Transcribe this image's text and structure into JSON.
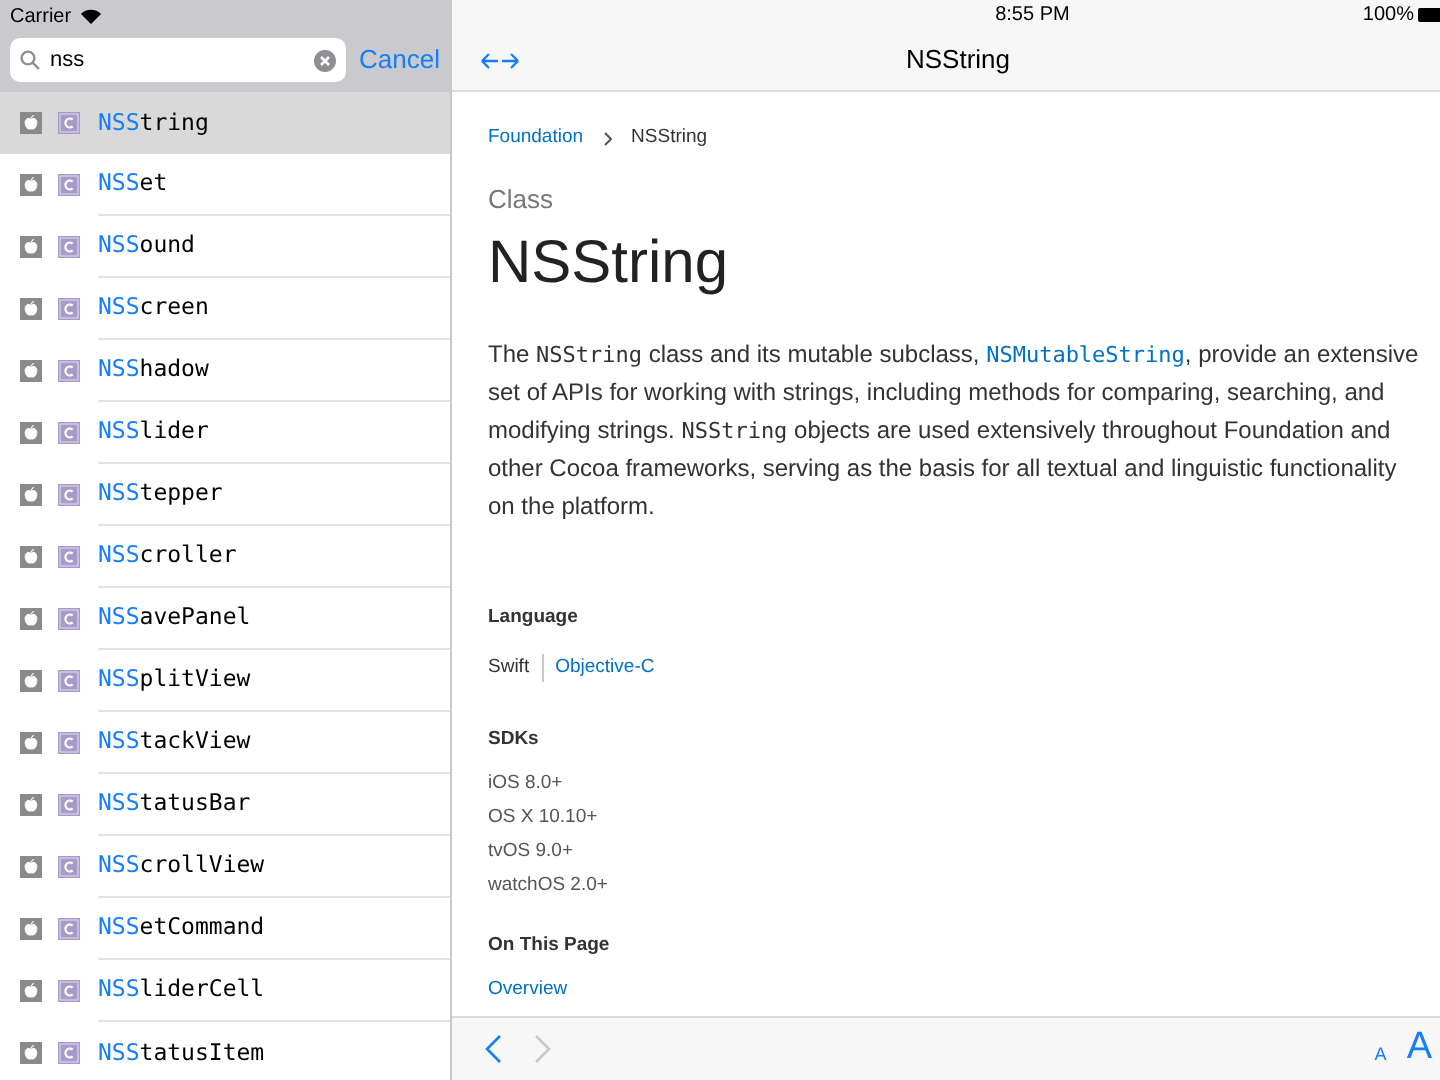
{
  "status_bar": {
    "carrier": "Carrier",
    "time": "8:55 PM",
    "battery": "100%"
  },
  "search": {
    "value": "nss",
    "cancel": "Cancel"
  },
  "results": [
    {
      "match": "NSS",
      "rest": "tring",
      "selected": true
    },
    {
      "match": "NSS",
      "rest": "et",
      "selected": false
    },
    {
      "match": "NSS",
      "rest": "ound",
      "selected": false
    },
    {
      "match": "NSS",
      "rest": "creen",
      "selected": false
    },
    {
      "match": "NSS",
      "rest": "hadow",
      "selected": false
    },
    {
      "match": "NSS",
      "rest": "lider",
      "selected": false
    },
    {
      "match": "NSS",
      "rest": "tepper",
      "selected": false
    },
    {
      "match": "NSS",
      "rest": "croller",
      "selected": false
    },
    {
      "match": "NSS",
      "rest": "avePanel",
      "selected": false
    },
    {
      "match": "NSS",
      "rest": "plitView",
      "selected": false
    },
    {
      "match": "NSS",
      "rest": "tackView",
      "selected": false
    },
    {
      "match": "NSS",
      "rest": "tatusBar",
      "selected": false
    },
    {
      "match": "NSS",
      "rest": "crollView",
      "selected": false
    },
    {
      "match": "NSS",
      "rest": "etCommand",
      "selected": false
    },
    {
      "match": "NSS",
      "rest": "liderCell",
      "selected": false
    },
    {
      "match": "NSS",
      "rest": "tatusItem",
      "selected": false
    }
  ],
  "nav_bar": {
    "title": "NSString"
  },
  "breadcrumb": [
    "Foundation",
    "NSString"
  ],
  "kind": "Class",
  "title": "NSString",
  "description": [
    {
      "kind": "text",
      "text": "The "
    },
    {
      "kind": "code",
      "text": "NSString"
    },
    {
      "kind": "text",
      "text": " class and its mutable subclass, "
    },
    {
      "kind": "link",
      "text": "NSMutableString"
    },
    {
      "kind": "text",
      "text": ", provide an extensive set of APIs for working with strings, including methods for comparing, searching, and modifying strings. "
    },
    {
      "kind": "code",
      "text": "NSString"
    },
    {
      "kind": "text",
      "text": " objects are used extensively throughout Foundation and other Cocoa frameworks, serving as the basis for all textual and linguistic functionality on the platform."
    }
  ],
  "language": {
    "heading": "Language",
    "options": [
      {
        "label": "Swift",
        "selected": true
      },
      {
        "label": "Objective-C",
        "selected": false
      }
    ]
  },
  "sdks": {
    "heading": "SDKs",
    "items": [
      "iOS 8.0+",
      "OS X 10.10+",
      "tvOS 9.0+",
      "watchOS 2.0+"
    ]
  },
  "on_this_page": {
    "heading": "On This Page",
    "links": [
      "Overview"
    ]
  },
  "toolbar": {
    "back_enabled": true,
    "forward_enabled": false,
    "small_font": "A",
    "large_font": "A"
  }
}
